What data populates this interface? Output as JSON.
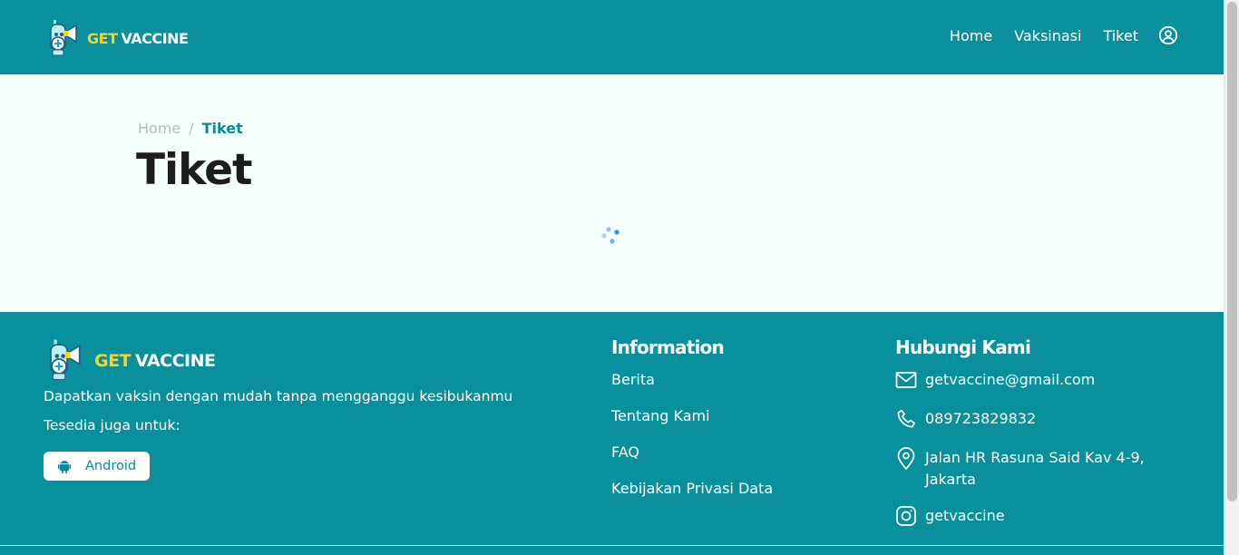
{
  "header": {
    "logo": {
      "get": "GET",
      "vaccine": "VACCINE"
    },
    "nav": [
      {
        "label": "Home"
      },
      {
        "label": "Vaksinasi"
      },
      {
        "label": "Tiket"
      }
    ],
    "user_icon": "user-circle-icon"
  },
  "breadcrumb": {
    "home": "Home",
    "separator": "/",
    "current": "Tiket"
  },
  "page": {
    "title": "Tiket",
    "loading_icon": "spinner-icon"
  },
  "footer": {
    "logo": {
      "get": "GET",
      "vaccine": "VACCINE"
    },
    "tagline": "Dapatkan vaksin dengan mudah tanpa mengganggu kesibukanmu",
    "available": "Tesedia juga untuk:",
    "android_button": "Android",
    "information": {
      "title": "Information",
      "links": [
        "Berita",
        "Tentang Kami",
        "FAQ",
        "Kebijakan Privasi Data"
      ]
    },
    "contact": {
      "title": "Hubungi Kami",
      "email": "getvaccine@gmail.com",
      "phone": "089723829832",
      "address": "Jalan HR Rasuna Said Kav 4-9, Jakarta",
      "instagram": "getvaccine"
    }
  },
  "colors": {
    "primary": "#0a909d",
    "accent": "#f5d32c",
    "page_bg": "#f4fffe"
  }
}
